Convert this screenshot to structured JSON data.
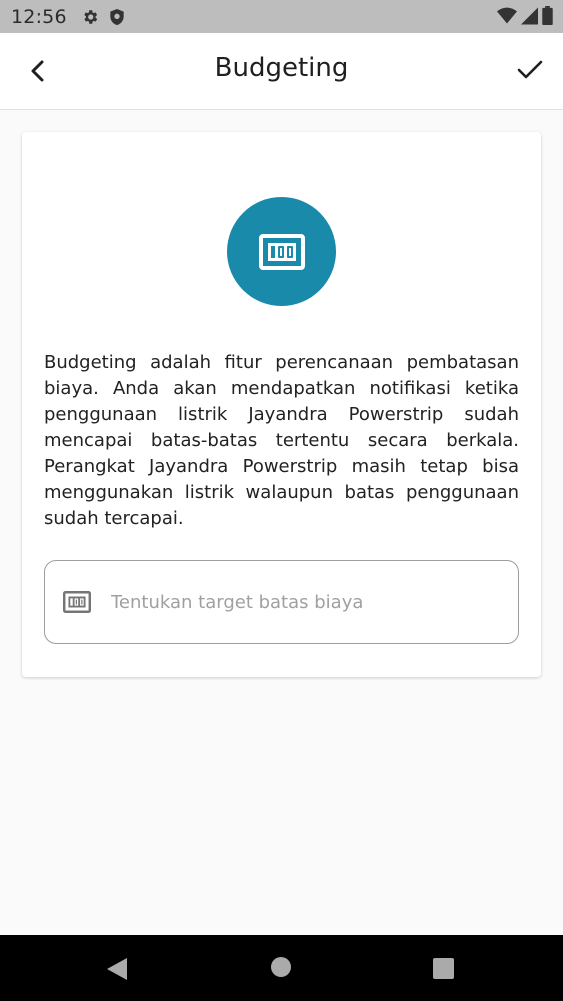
{
  "status_bar": {
    "time": "12:56"
  },
  "app_bar": {
    "title": "Budgeting"
  },
  "card": {
    "description": "Budgeting adalah fitur perencanaan pembatasan biaya. Anda akan mendapatkan notifikasi ketika penggunaan listrik Jayandra Powerstrip sudah mencapai batas-batas tertentu secara berkala. Perangkat Jayandra Powerstrip masih tetap bisa menggunakan listrik walaupun batas penggunaan sudah tercapai.",
    "input": {
      "placeholder": "Tentukan target batas biaya",
      "value": ""
    }
  },
  "colors": {
    "accent": "#1a8aab",
    "status_bar": "#bdbdbd",
    "background": "#fafafa"
  },
  "icons": [
    "settings-icon",
    "shield-icon",
    "wifi-icon",
    "signal-icon",
    "battery-icon",
    "back-arrow-icon",
    "check-icon",
    "money-100-icon",
    "nav-back-icon",
    "nav-home-icon",
    "nav-recents-icon"
  ]
}
